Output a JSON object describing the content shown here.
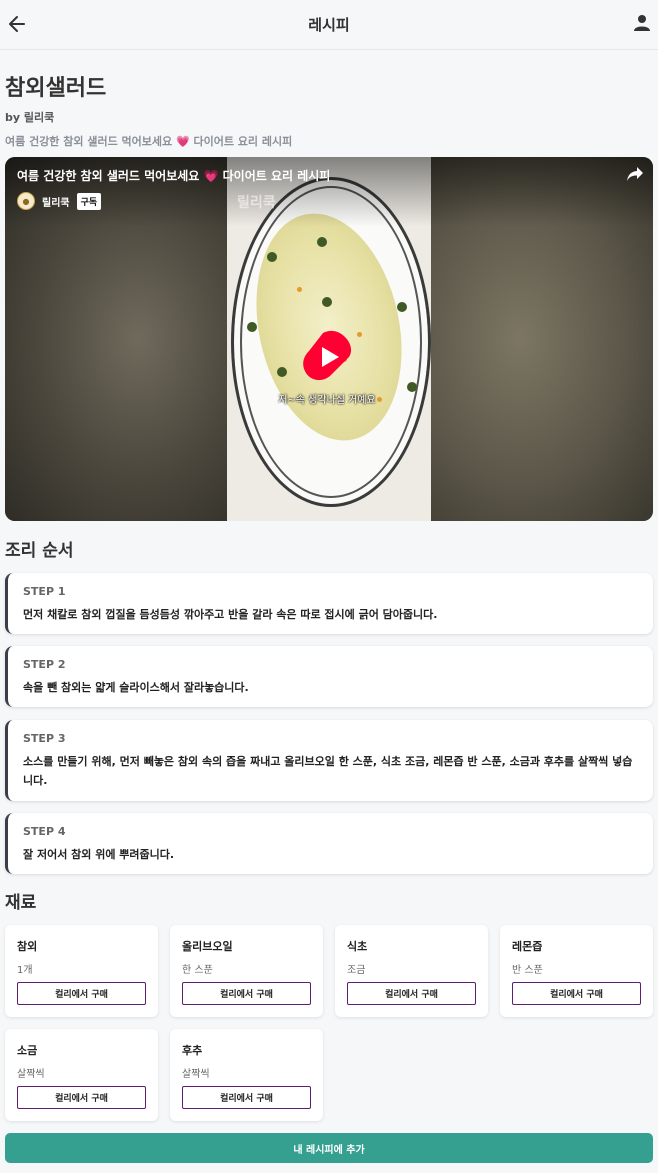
{
  "header": {
    "title": "레시피",
    "back_icon": "arrow-left-icon",
    "user_icon": "user-icon"
  },
  "recipe": {
    "title": "참외샐러드",
    "author": "by 릴리쿡",
    "description": "여름 건강한 참외 샐러드 먹어보세요 💗 다이어트 요리 레시피"
  },
  "video": {
    "title": "여름 건강한 참외 샐러드 먹어보세요 💗 다이어트 요리 레시피",
    "channel": "릴리쿡",
    "subscribe": "구독",
    "watermark": "릴리쿡",
    "caption": "저~속 생각나실 거예요"
  },
  "steps_section": {
    "title": "조리 순서",
    "steps": [
      {
        "label": "STEP 1",
        "text": "먼저 채칼로 참외 껍질을 듬성듬성 깎아주고 반을 갈라 속은 따로 접시에 긁어 담아줍니다."
      },
      {
        "label": "STEP 2",
        "text": "속을 뺀 참외는 얇게 슬라이스해서 잘라놓습니다."
      },
      {
        "label": "STEP 3",
        "text": "소스를 만들기 위해, 먼저 빼놓은 참외 속의 즙을 짜내고 올리브오일 한 스푼, 식초 조금, 레몬즙 반 스푼, 소금과 후추를 살짝씩 넣습니다."
      },
      {
        "label": "STEP 4",
        "text": "잘 저어서 참외 위에 뿌려줍니다."
      }
    ]
  },
  "ingredients_section": {
    "title": "재료",
    "buy_label": "컬리에서 구매",
    "items": [
      {
        "name": "참외",
        "amount": "1개"
      },
      {
        "name": "올리브오일",
        "amount": "한 스푼"
      },
      {
        "name": "식초",
        "amount": "조금"
      },
      {
        "name": "레몬즙",
        "amount": "반 스푼"
      },
      {
        "name": "소금",
        "amount": "살짝씩"
      },
      {
        "name": "후추",
        "amount": "살짝씩"
      }
    ]
  },
  "actions": {
    "add_label": "내 레시피에 추가"
  },
  "colors": {
    "accent": "#35a090",
    "buy_border": "#5f1e6f",
    "play": "#ff0033"
  }
}
